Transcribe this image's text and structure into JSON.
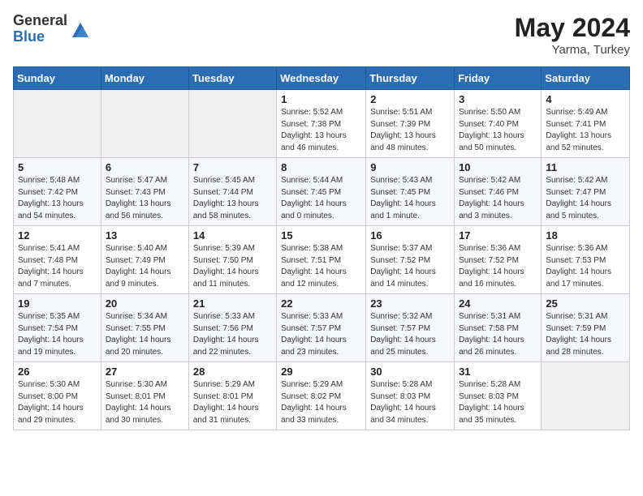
{
  "header": {
    "logo_general": "General",
    "logo_blue": "Blue",
    "month_year": "May 2024",
    "location": "Yarma, Turkey"
  },
  "days_of_week": [
    "Sunday",
    "Monday",
    "Tuesday",
    "Wednesday",
    "Thursday",
    "Friday",
    "Saturday"
  ],
  "weeks": [
    [
      {
        "day": "",
        "info": ""
      },
      {
        "day": "",
        "info": ""
      },
      {
        "day": "",
        "info": ""
      },
      {
        "day": "1",
        "info": "Sunrise: 5:52 AM\nSunset: 7:38 PM\nDaylight: 13 hours and 46 minutes."
      },
      {
        "day": "2",
        "info": "Sunrise: 5:51 AM\nSunset: 7:39 PM\nDaylight: 13 hours and 48 minutes."
      },
      {
        "day": "3",
        "info": "Sunrise: 5:50 AM\nSunset: 7:40 PM\nDaylight: 13 hours and 50 minutes."
      },
      {
        "day": "4",
        "info": "Sunrise: 5:49 AM\nSunset: 7:41 PM\nDaylight: 13 hours and 52 minutes."
      }
    ],
    [
      {
        "day": "5",
        "info": "Sunrise: 5:48 AM\nSunset: 7:42 PM\nDaylight: 13 hours and 54 minutes."
      },
      {
        "day": "6",
        "info": "Sunrise: 5:47 AM\nSunset: 7:43 PM\nDaylight: 13 hours and 56 minutes."
      },
      {
        "day": "7",
        "info": "Sunrise: 5:45 AM\nSunset: 7:44 PM\nDaylight: 13 hours and 58 minutes."
      },
      {
        "day": "8",
        "info": "Sunrise: 5:44 AM\nSunset: 7:45 PM\nDaylight: 14 hours and 0 minutes."
      },
      {
        "day": "9",
        "info": "Sunrise: 5:43 AM\nSunset: 7:45 PM\nDaylight: 14 hours and 1 minute."
      },
      {
        "day": "10",
        "info": "Sunrise: 5:42 AM\nSunset: 7:46 PM\nDaylight: 14 hours and 3 minutes."
      },
      {
        "day": "11",
        "info": "Sunrise: 5:42 AM\nSunset: 7:47 PM\nDaylight: 14 hours and 5 minutes."
      }
    ],
    [
      {
        "day": "12",
        "info": "Sunrise: 5:41 AM\nSunset: 7:48 PM\nDaylight: 14 hours and 7 minutes."
      },
      {
        "day": "13",
        "info": "Sunrise: 5:40 AM\nSunset: 7:49 PM\nDaylight: 14 hours and 9 minutes."
      },
      {
        "day": "14",
        "info": "Sunrise: 5:39 AM\nSunset: 7:50 PM\nDaylight: 14 hours and 11 minutes."
      },
      {
        "day": "15",
        "info": "Sunrise: 5:38 AM\nSunset: 7:51 PM\nDaylight: 14 hours and 12 minutes."
      },
      {
        "day": "16",
        "info": "Sunrise: 5:37 AM\nSunset: 7:52 PM\nDaylight: 14 hours and 14 minutes."
      },
      {
        "day": "17",
        "info": "Sunrise: 5:36 AM\nSunset: 7:52 PM\nDaylight: 14 hours and 16 minutes."
      },
      {
        "day": "18",
        "info": "Sunrise: 5:36 AM\nSunset: 7:53 PM\nDaylight: 14 hours and 17 minutes."
      }
    ],
    [
      {
        "day": "19",
        "info": "Sunrise: 5:35 AM\nSunset: 7:54 PM\nDaylight: 14 hours and 19 minutes."
      },
      {
        "day": "20",
        "info": "Sunrise: 5:34 AM\nSunset: 7:55 PM\nDaylight: 14 hours and 20 minutes."
      },
      {
        "day": "21",
        "info": "Sunrise: 5:33 AM\nSunset: 7:56 PM\nDaylight: 14 hours and 22 minutes."
      },
      {
        "day": "22",
        "info": "Sunrise: 5:33 AM\nSunset: 7:57 PM\nDaylight: 14 hours and 23 minutes."
      },
      {
        "day": "23",
        "info": "Sunrise: 5:32 AM\nSunset: 7:57 PM\nDaylight: 14 hours and 25 minutes."
      },
      {
        "day": "24",
        "info": "Sunrise: 5:31 AM\nSunset: 7:58 PM\nDaylight: 14 hours and 26 minutes."
      },
      {
        "day": "25",
        "info": "Sunrise: 5:31 AM\nSunset: 7:59 PM\nDaylight: 14 hours and 28 minutes."
      }
    ],
    [
      {
        "day": "26",
        "info": "Sunrise: 5:30 AM\nSunset: 8:00 PM\nDaylight: 14 hours and 29 minutes."
      },
      {
        "day": "27",
        "info": "Sunrise: 5:30 AM\nSunset: 8:01 PM\nDaylight: 14 hours and 30 minutes."
      },
      {
        "day": "28",
        "info": "Sunrise: 5:29 AM\nSunset: 8:01 PM\nDaylight: 14 hours and 31 minutes."
      },
      {
        "day": "29",
        "info": "Sunrise: 5:29 AM\nSunset: 8:02 PM\nDaylight: 14 hours and 33 minutes."
      },
      {
        "day": "30",
        "info": "Sunrise: 5:28 AM\nSunset: 8:03 PM\nDaylight: 14 hours and 34 minutes."
      },
      {
        "day": "31",
        "info": "Sunrise: 5:28 AM\nSunset: 8:03 PM\nDaylight: 14 hours and 35 minutes."
      },
      {
        "day": "",
        "info": ""
      }
    ]
  ]
}
